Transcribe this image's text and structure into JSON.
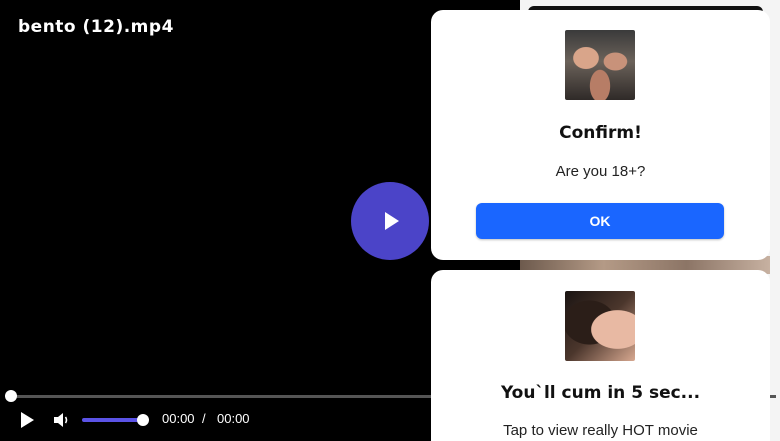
{
  "player": {
    "title": "bento (12).mp4",
    "current_time": "00:00",
    "separator": "/",
    "total_time": "00:00",
    "progress_fraction": 0,
    "volume_fraction": 1.0,
    "accent_color": "#5b53e6",
    "big_play_color": "#4b44c8",
    "icons": {
      "big_play": "play-icon",
      "play": "play-icon",
      "volume": "volume-icon"
    }
  },
  "popups": [
    {
      "title": "Confirm!",
      "message": "Are you 18+?",
      "button_label": "OK",
      "button_color": "#1a66ff"
    },
    {
      "title": "You`ll cum in 5 sec...",
      "message": "Tap to view really HOT movie"
    }
  ]
}
